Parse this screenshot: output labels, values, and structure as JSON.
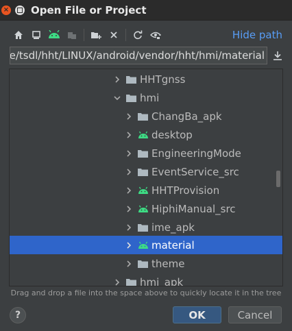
{
  "window": {
    "title": "Open File or Project",
    "close_glyph": "×"
  },
  "toolbar": {
    "icons": [
      "home-icon",
      "desktop-icon",
      "android-project-icon",
      "module-icon",
      "new-folder-icon",
      "delete-icon",
      "refresh-icon",
      "show-hidden-icon"
    ],
    "hide_path_label": "Hide path"
  },
  "path": {
    "value": "/home/tsdl/hht/LINUX/android/vendor/hht/hmi/material",
    "visible_text": "ne/tsdl/hht/LINUX/android/vendor/hht/hmi/material"
  },
  "tree": {
    "rows": [
      {
        "label": "HHTgnss",
        "icon": "folder-icon",
        "expanded": false,
        "selected": false
      },
      {
        "label": "hmi",
        "icon": "folder-icon",
        "expanded": true,
        "selected": false
      },
      {
        "label": "ChangBa_apk",
        "icon": "folder-icon",
        "expanded": false,
        "selected": false
      },
      {
        "label": "desktop",
        "icon": "android-icon",
        "expanded": false,
        "selected": false
      },
      {
        "label": "EngineeringMode",
        "icon": "folder-icon",
        "expanded": false,
        "selected": false
      },
      {
        "label": "EventService_src",
        "icon": "folder-icon",
        "expanded": false,
        "selected": false
      },
      {
        "label": "HHTProvision",
        "icon": "android-icon",
        "expanded": false,
        "selected": false
      },
      {
        "label": "HiphiManual_src",
        "icon": "android-icon",
        "expanded": false,
        "selected": false
      },
      {
        "label": "ime_apk",
        "icon": "folder-icon",
        "expanded": false,
        "selected": false
      },
      {
        "label": "material",
        "icon": "android-icon",
        "expanded": false,
        "selected": true
      },
      {
        "label": "theme",
        "icon": "folder-icon",
        "expanded": false,
        "selected": false
      },
      {
        "label": "hmi_apk",
        "icon": "folder-icon",
        "expanded": false,
        "selected": false
      }
    ]
  },
  "hint": "Drag and drop a file into the space above to quickly locate it in the tree",
  "buttons": {
    "help": "?",
    "ok": "OK",
    "cancel": "Cancel"
  },
  "colors": {
    "accent_link": "#589df6",
    "selection": "#2f65ca",
    "android_green": "#3ddc84",
    "folder": "#aeb9c0"
  }
}
